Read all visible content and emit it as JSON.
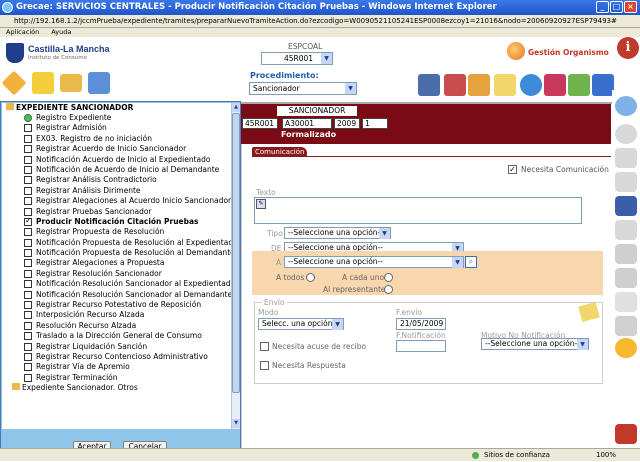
{
  "window": {
    "title": "Grecae: SERVICIOS CENTRALES - Producir Notificación Citación Pruebas - Windows Internet Explorer",
    "url": "http://192.168.1.2/jccmPrueba/expediente/tramites/prepararNuevoTramiteAction.do?ezcodigo=W0090521105241ESP0008ezcoy1=21016&nodo=20060920927ESP79493#",
    "menu": [
      "Aplicación",
      "Ayuda"
    ]
  },
  "header": {
    "logo_name": "Castilla-La Mancha",
    "logo_sub": "Instituto de Consumo",
    "espcoal_label": "ESPCOAL",
    "espcoal_value": "45R001",
    "gestion_label": "Gestión Organismo",
    "info_glyph": "i"
  },
  "toolbar": {
    "procedimiento_label": "Procedimiento:",
    "procedimiento_value": "Sancionador"
  },
  "tree": {
    "root_label": "EXPEDIENTE SANCIONADOR",
    "items": [
      {
        "label": "Registro Expediente",
        "state": "green"
      },
      {
        "label": "Registrar Admisión",
        "state": ""
      },
      {
        "label": "EX03. Registro de no iniciación",
        "state": ""
      },
      {
        "label": "Registrar Acuerdo de Inicio Sancionador",
        "state": ""
      },
      {
        "label": "Notificación Acuerdo de Inicio al Expedientado",
        "state": ""
      },
      {
        "label": "Notificación de Acuerdo de Inicio al Demandante",
        "state": ""
      },
      {
        "label": "Registrar Análisis Contradictorio",
        "state": ""
      },
      {
        "label": "Registrar Análisis Dirimente",
        "state": ""
      },
      {
        "label": "Registrar Alegaciones al Acuerdo Inicio Sancionador",
        "state": ""
      },
      {
        "label": "Registrar Pruebas Sancionador",
        "state": ""
      },
      {
        "label": "Producir Notificación Citación Pruebas",
        "state": "checked active"
      },
      {
        "label": "Registrar Propuesta de Resolución",
        "state": ""
      },
      {
        "label": "Notificación Propuesta de Resolución al Expedientado",
        "state": ""
      },
      {
        "label": "Notificación Propuesta de Resolución al Demandante",
        "state": ""
      },
      {
        "label": "Registrar Alegaciones a Propuesta",
        "state": ""
      },
      {
        "label": "Registrar Resolución Sancionador",
        "state": ""
      },
      {
        "label": "Notificación Resolución Sancionador al Expedientado",
        "state": ""
      },
      {
        "label": "Notificación Resolución Sancionador al Demandante",
        "state": ""
      },
      {
        "label": "Registrar Recurso Potestativo de Reposición",
        "state": ""
      },
      {
        "label": "Interposición Recurso Alzada",
        "state": ""
      },
      {
        "label": "Resolución Recurso Alzada",
        "state": ""
      },
      {
        "label": "Traslado a la Dirección General de Consumo",
        "state": ""
      },
      {
        "label": "Registrar Liquidación Sanción",
        "state": ""
      },
      {
        "label": "Registrar Recurso Contencioso Administrativo",
        "state": ""
      },
      {
        "label": "Registrar Vía de Apremio",
        "state": ""
      },
      {
        "label": "Registrar Terminación",
        "state": ""
      }
    ],
    "folder_label": "Expediente Sancionador. Otros",
    "accept_label": "Aceptar",
    "cancel_label": "Cancelar"
  },
  "tramite": {
    "title": "SANCIONADOR",
    "cells": [
      "45R001",
      "A30001",
      "2009",
      "1"
    ],
    "status": "Formalizado"
  },
  "form": {
    "tab_label": "Comunicación",
    "necesita_comunicacion": "Necesita Comunicación",
    "texto_label": "Texto",
    "tipo_label": "Tipo",
    "tipo_value": "--Seleccione una opción--",
    "de_label": "DE",
    "de_value": "--Seleccione una opción--",
    "a_label": "A",
    "a_value": "--Seleccione una opción--",
    "a_todos": "A todos",
    "a_cada_uno": "A cada uno",
    "al_representante": "Al representante",
    "envio_title": "Envío",
    "modo_label": "Modo",
    "modo_value": "Selecc. una opción",
    "fenvio_label": "F.envío",
    "fenvio_value": "21/05/2009",
    "fnotificacion_label": "F.Notificación",
    "acuse_label": "Necesita acuse de recibo",
    "motivo_label": "Motivo No Notificación",
    "motivo_value": "--Seleccione una opción--",
    "respuesta_label": "Necesita Respuesta"
  },
  "statusbar": {
    "zone": "Sitios de confianza",
    "zoom": "100%"
  },
  "colors": {
    "titlebar": "#1f55c9",
    "tramite_bg": "#7a0a14",
    "orange_band": "#f9d7ae",
    "dropdown_bg": "#8fc5e8"
  }
}
